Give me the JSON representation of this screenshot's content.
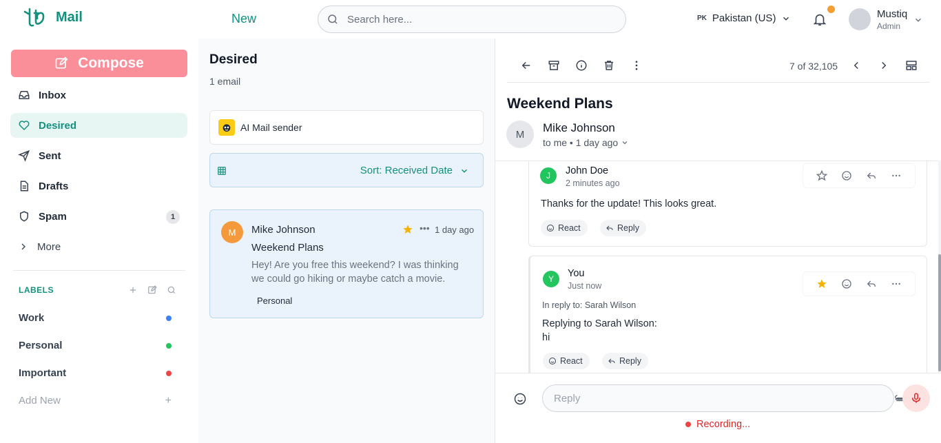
{
  "header": {
    "app_name": "Mail",
    "new_label": "New",
    "search_placeholder": "Search here...",
    "country_code": "PK",
    "country": "Pakistan (US)",
    "user_name": "Mustiq",
    "user_role": "Admin",
    "notification_dot_color": "#f59e32"
  },
  "sidebar": {
    "compose_label": "Compose",
    "items": [
      {
        "label": "Inbox",
        "icon": "inbox-icon"
      },
      {
        "label": "Desired",
        "icon": "heart-icon",
        "active": true
      },
      {
        "label": "Sent",
        "icon": "send-icon"
      },
      {
        "label": "Drafts",
        "icon": "document-icon"
      },
      {
        "label": "Spam",
        "icon": "shield-icon",
        "count": "1"
      },
      {
        "label": "More",
        "icon": "chevron-right-icon"
      }
    ],
    "labels_heading": "LABELS",
    "labels": [
      {
        "name": "Work",
        "color": "#3b82f6"
      },
      {
        "name": "Personal",
        "color": "#22c55e"
      },
      {
        "name": "Important",
        "color": "#ef4444"
      }
    ],
    "add_new_label": "Add New"
  },
  "list": {
    "title": "Desired",
    "count_text": "1 email",
    "sender_filter": "AI Mail sender",
    "sort_label": "Sort: Received Date",
    "emails": [
      {
        "avatar": "M",
        "from": "Mike Johnson",
        "time": "1 day ago",
        "subject": "Weekend Plans",
        "preview": "Hey! Are you free this weekend? I was thinking we could go hiking or maybe catch a movie.",
        "tag": "Personal",
        "starred": true
      }
    ]
  },
  "reader": {
    "pager": "7 of 32,105",
    "title": "Weekend Plans",
    "avatar": "M",
    "from": "Mike Johnson",
    "meta": "to me • 1 day ago",
    "messages": [
      {
        "avatar": "J",
        "name": "John Doe",
        "time": "2 minutes ago",
        "body": "Thanks for the update! This looks great.",
        "react_label": "React",
        "reply_label": "Reply",
        "starred": false
      },
      {
        "avatar": "Y",
        "name": "You",
        "time": "Just now",
        "reply_to": "In reply to: Sarah Wilson",
        "body_line1": "Replying to Sarah Wilson:",
        "body_line2": "hi",
        "react_label": "React",
        "reply_label": "Reply",
        "starred": true
      }
    ],
    "reply_placeholder": "Reply",
    "recording_text": "Recording..."
  },
  "colors": {
    "accent": "#14907f",
    "compose": "#fa8f99",
    "star": "#f5b301",
    "recording": "#dc2626"
  }
}
